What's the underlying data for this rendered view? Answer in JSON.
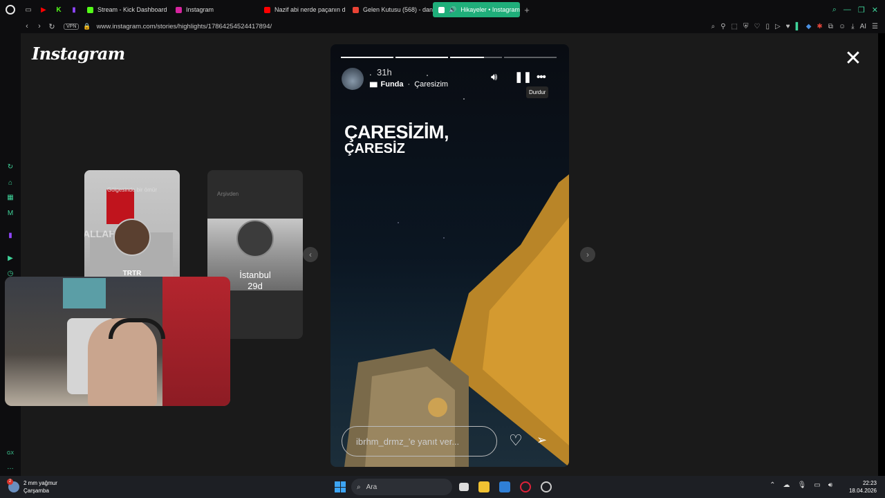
{
  "browser": {
    "tabs": [
      {
        "label": "Stream - Kick Dashboard",
        "color": "#53fc18"
      },
      {
        "label": "Instagram",
        "color": "#d6249f"
      },
      {
        "label": "Nazif abi nerde paçanın d",
        "color": "#ff0000"
      },
      {
        "label": "Gelen Kutusu (568) - danı",
        "color": "#ea4335"
      },
      {
        "label": "Hikayeler • Instagram",
        "color": "#d6249f",
        "active": true
      }
    ],
    "vpn_label": "VPN",
    "url": "www.instagram.com/stories/highlights/17864254524417894/",
    "accent_color": "#1fae7a"
  },
  "instagram": {
    "logo_text": "Instagram",
    "close_icon": "close-icon",
    "left_card": {
      "caption": "Gölgesinde bir ömür",
      "ghost_text": "ALLAH",
      "name": "TRTR"
    },
    "right_card": {
      "caption": "Arşivden",
      "name": "İstanbul",
      "time": "29d"
    },
    "story": {
      "username": ".",
      "time": "31h",
      "music_artist": "Funda",
      "music_separator": "·",
      "music_song": "Çaresizim",
      "pause_tooltip": "Durdur",
      "headline_line1": "ÇARESİZİM,",
      "headline_line2": "ÇARESİZ",
      "reply_placeholder": "ibrhm_drmz_'e yanıt ver...",
      "progress": [
        1.0,
        1.0,
        0.65,
        0.0
      ]
    }
  },
  "taskbar": {
    "weather_temp": "2 mm yağmur",
    "weather_day": "Çarşamba",
    "weather_badge": "2",
    "search_label": "Ara",
    "time": "22:23",
    "date": "18.04.2026"
  }
}
